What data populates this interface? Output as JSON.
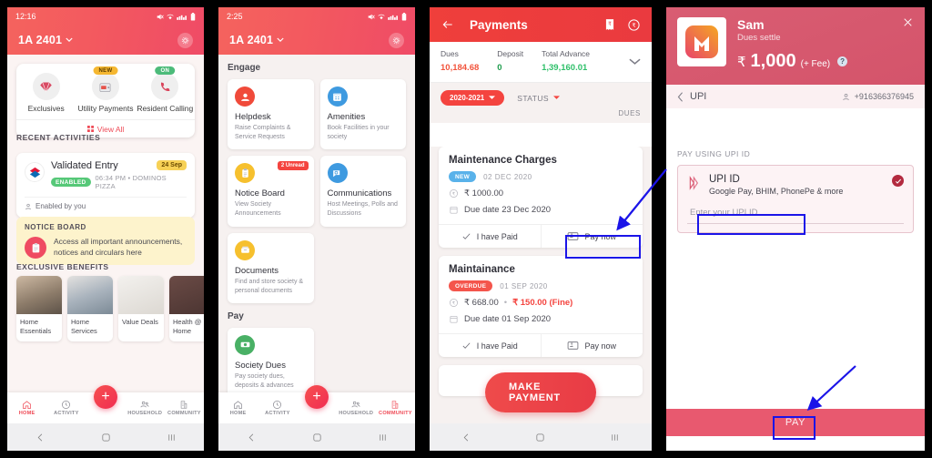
{
  "panel1": {
    "status": {
      "time": "12:16",
      "icons": [
        "mute-icon",
        "wifi-icon",
        "signal-icon",
        "battery-icon"
      ]
    },
    "header": {
      "unit": "1A 2401",
      "chevron": "⌄",
      "settings_icon": "gear-icon"
    },
    "quick_actions": [
      {
        "label": "Exclusives",
        "icon": "diamond-icon",
        "badge": ""
      },
      {
        "label": "Utility\nPayments",
        "icon": "wallet-icon",
        "badge": "NEW"
      },
      {
        "label": "Resident\nCalling",
        "icon": "phone-icon",
        "badge": "ON"
      }
    ],
    "view_all": "View All",
    "recent_activities_title": "RECENT ACTIVITIES",
    "activity": {
      "title": "Validated Entry",
      "status_pill": "ENABLED",
      "meta": "06:34 PM • DOMINOS PIZZA",
      "date_pill": "24 Sep",
      "footer": "Enabled by you"
    },
    "notice": {
      "title": "NOTICE BOARD",
      "text": "Access all important announcements, notices and circulars here"
    },
    "benefits_title": "EXCLUSIVE BENEFITS",
    "benefits": [
      {
        "label": "Home Essentials"
      },
      {
        "label": "Home Services"
      },
      {
        "label": "Value Deals"
      },
      {
        "label": "Health @ Home"
      }
    ],
    "tabs": [
      {
        "label": "HOME",
        "icon": "home-icon",
        "active": true
      },
      {
        "label": "ACTIVITY",
        "icon": "clock-icon",
        "active": false
      },
      {
        "label": "HOUSEHOLD",
        "icon": "people-icon",
        "active": false
      },
      {
        "label": "COMMUNITY",
        "icon": "building-icon",
        "active": false
      }
    ],
    "fab": "+"
  },
  "panel2": {
    "status": {
      "time": "2:25"
    },
    "header": {
      "unit": "1A 2401",
      "settings_icon": "gear-icon"
    },
    "section_engage": "Engage",
    "engage_cards": [
      {
        "title": "Helpdesk",
        "sub": "Raise Complaints & Service Requests",
        "icon": "helpdesk-icon",
        "color": "#f04a3a",
        "badge": ""
      },
      {
        "title": "Amenities",
        "sub": "Book Facilities in your society",
        "icon": "calendar-icon",
        "color": "#3e9ae0",
        "badge": ""
      },
      {
        "title": "Notice Board",
        "sub": "View Society Announcements",
        "icon": "clipboard-icon",
        "color": "#f6c02e",
        "badge": "2 Unread"
      },
      {
        "title": "Communications",
        "sub": "Host Meetings, Polls and Discussions",
        "icon": "chat-icon",
        "color": "#3e9ae0",
        "badge": ""
      },
      {
        "title": "Documents",
        "sub": "Find and store society & personal documents",
        "icon": "archive-icon",
        "color": "#f6c02e",
        "badge": ""
      }
    ],
    "section_pay": "Pay",
    "pay_cards": [
      {
        "title": "Society Dues",
        "sub": "Pay society dues, deposits & advances",
        "icon": "money-icon",
        "color": "#49b065",
        "badge": ""
      }
    ],
    "tabs": [
      {
        "label": "HOME",
        "icon": "home-icon",
        "active": false
      },
      {
        "label": "ACTIVITY",
        "icon": "clock-icon",
        "active": false
      },
      {
        "label": "HOUSEHOLD",
        "icon": "people-icon",
        "active": false
      },
      {
        "label": "COMMUNITY",
        "icon": "building-icon",
        "active": true
      }
    ],
    "fab": "+"
  },
  "panel3": {
    "header": {
      "back_icon": "back-arrow-icon",
      "title": "Payments",
      "receipt_icon": "receipt-icon",
      "refund_icon": "rupee-refund-icon"
    },
    "summary": [
      {
        "label": "Dues",
        "value": "10,184.68",
        "color": "#f2543c"
      },
      {
        "label": "Deposit",
        "value": "0",
        "color": "#1f9d4e"
      },
      {
        "label": "Total Advance",
        "value": "1,39,160.01",
        "color": "#2fc06a"
      }
    ],
    "expand_icon": "chevron-down-icon",
    "filters": {
      "year": "2020-2021",
      "status": "STATUS"
    },
    "list_label": "DUES",
    "dues": [
      {
        "title": "Maintenance Charges",
        "pill": "NEW",
        "pill_type": "new",
        "date": "02 DEC 2020",
        "amount": "₹ 1000.00",
        "fine": "",
        "due_date": "Due date 23 Dec 2020",
        "action_paid": "I have Paid",
        "action_pay": "Pay now"
      },
      {
        "title": "Maintainance",
        "pill": "OVERDUE",
        "pill_type": "overdue",
        "date": "01 SEP 2020",
        "amount": "₹ 668.00",
        "fine": "₹ 150.00 (Fine)",
        "due_date": "Due date 01 Sep 2020",
        "action_paid": "I have Paid",
        "action_pay": "Pay now"
      }
    ],
    "make_payment": "MAKE PAYMENT"
  },
  "panel4": {
    "merchant": {
      "name": "Sam",
      "sub": "Dues settle",
      "logo": "mobikwik-logo-icon"
    },
    "amount": {
      "currency": "₹",
      "value": "1,000",
      "fee_note": "(+ Fee)",
      "help": "?"
    },
    "close_icon": "close-icon",
    "method_bar": {
      "back_icon": "back-chevron-icon",
      "label": "UPI",
      "phone": "+916366376945",
      "user_icon": "user-icon"
    },
    "pay_using_label": "PAY USING UPI ID",
    "upi": {
      "title": "UPI ID",
      "sub": "Google Pay, BHIM, PhonePe & more",
      "input_placeholder": "Enter your UPI ID",
      "input_value": "",
      "selected_icon": "check-circle-icon"
    },
    "pay_button": "PAY"
  },
  "annotations": {
    "highlight_color": "#1b14e8",
    "targets": [
      "pay-now-button",
      "upi-id-input",
      "pay-button"
    ]
  }
}
